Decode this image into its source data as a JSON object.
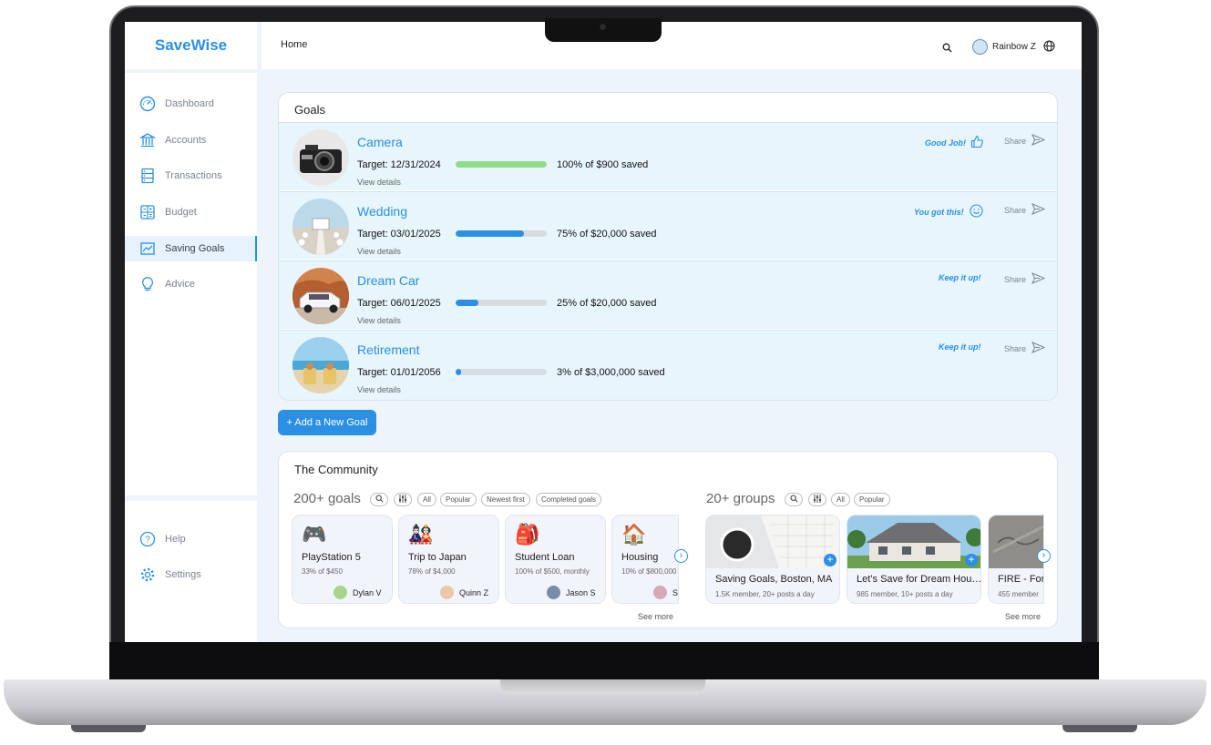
{
  "app": {
    "brand": "SaveWise",
    "breadcrumb": "Home",
    "user_name": "Rainbow Z"
  },
  "sidebar": {
    "items": [
      {
        "label": "Dashboard",
        "icon": "gauge-icon"
      },
      {
        "label": "Accounts",
        "icon": "bank-icon"
      },
      {
        "label": "Transactions",
        "icon": "server-icon"
      },
      {
        "label": "Budget",
        "icon": "calculator-icon"
      },
      {
        "label": "Saving Goals",
        "icon": "chart-line-icon",
        "active": true
      },
      {
        "label": "Advice",
        "icon": "lightbulb-icon"
      }
    ],
    "footer": [
      {
        "label": "Help",
        "icon": "help-icon"
      },
      {
        "label": "Settings",
        "icon": "gear-icon"
      }
    ]
  },
  "goals": {
    "title": "Goals",
    "items": [
      {
        "name": "Camera",
        "target": "Target: 12/31/2024",
        "progress": 1.0,
        "bar_color": "#8fdc8a",
        "saved": "100% of $900 saved",
        "details": "View details",
        "cheer": "Good Job!",
        "cheer_icon": "thumbs-up-icon",
        "share": "Share"
      },
      {
        "name": "Wedding",
        "target": "Target: 03/01/2025",
        "progress": 0.75,
        "bar_color": "#2b8fe3",
        "saved": "75% of $20,000 saved",
        "details": "View details",
        "cheer": "You got this!",
        "cheer_icon": "smiley-icon",
        "share": "Share"
      },
      {
        "name": "Dream Car",
        "target": "Target: 06/01/2025",
        "progress": 0.25,
        "bar_color": "#2b8fe3",
        "saved": "25% of $20,000 saved",
        "details": "View details",
        "cheer": "Keep it up!",
        "share": "Share"
      },
      {
        "name": "Retirement",
        "target": "Target: 01/01/2056",
        "progress": 0.03,
        "bar_color": "#2b8fe3",
        "saved": "3% of $3,000,000 saved",
        "details": "View details",
        "cheer": "Keep it up!",
        "share": "Share"
      }
    ],
    "add_button": "+ Add a New Goal"
  },
  "community": {
    "title": "The Community",
    "goals_count": "200+ goals",
    "goals_filters": [
      "All",
      "Popular",
      "Newest first",
      "Completed goals"
    ],
    "goal_cards": [
      {
        "title": "PlayStation 5",
        "sub": "33% of $450",
        "user": "Dylan V",
        "icon": "gamepad-icon"
      },
      {
        "title": "Trip to Japan",
        "sub": "78% of $4,000",
        "user": "Quinn Z",
        "icon": "japan-dolls-icon"
      },
      {
        "title": "Student Loan",
        "sub": "100% of $500, monthly",
        "user": "Jason S",
        "icon": "backpack-icon"
      },
      {
        "title": "Housing",
        "sub": "10% of $800,000",
        "user": "S",
        "icon": "house-icon"
      }
    ],
    "goals_see_more": "See more",
    "groups_count": "20+ groups",
    "groups_filters": [
      "All",
      "Popular"
    ],
    "groups": [
      {
        "title": "Saving Goals, Boston, MA",
        "sub": "1.5K member, 20+ posts a day"
      },
      {
        "title": "Let’s Save for Dream Hou…",
        "sub": "985 member, 10+ posts a day"
      },
      {
        "title": "FIRE - For",
        "sub": "455 member"
      }
    ],
    "groups_see_more": "See more"
  },
  "colors": {
    "accent": "#2b8fe3",
    "success": "#8fdc8a"
  }
}
